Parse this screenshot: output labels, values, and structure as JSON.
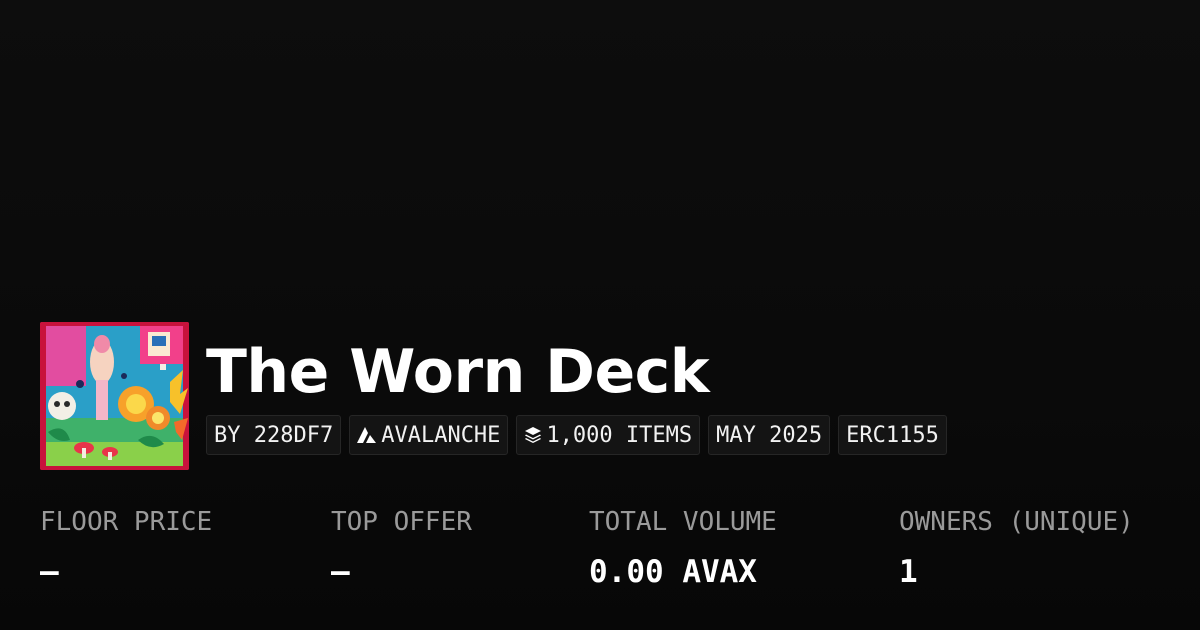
{
  "collection": {
    "title": "The Worn Deck",
    "creator": "BY 228DF7",
    "chain": "AVALANCHE",
    "items": "1,000 ITEMS",
    "date": "MAY 2025",
    "standard": "ERC1155",
    "chain_icon": "avalanche-logo",
    "items_icon": "stack-layers-icon"
  },
  "stats": [
    {
      "label": "FLOOR PRICE",
      "value": "—"
    },
    {
      "label": "TOP OFFER",
      "value": "—"
    },
    {
      "label": "TOTAL VOLUME",
      "value": "0.00 AVAX"
    },
    {
      "label": "OWNERS (UNIQUE)",
      "value": "1"
    }
  ],
  "colors": {
    "background": "#0b0b0b",
    "tag_background": "#141414",
    "label_gray": "#9a9a9a",
    "text": "#ffffff"
  }
}
